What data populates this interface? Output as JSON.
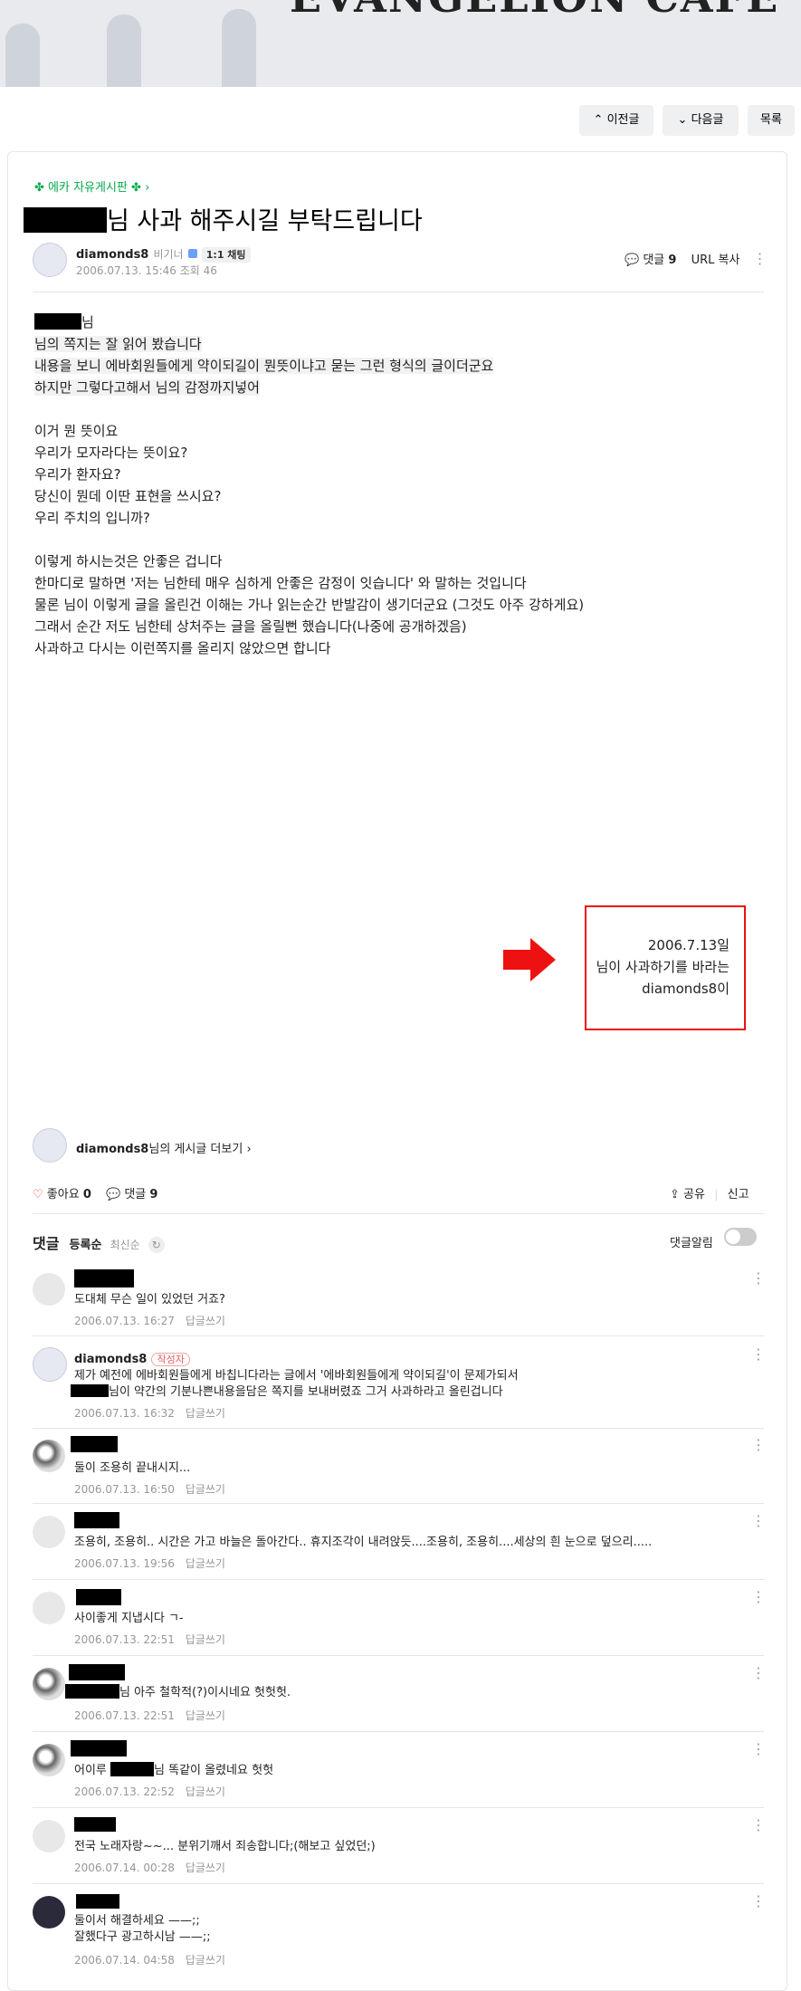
{
  "banner": {
    "title": "EVANGELION CAFE"
  },
  "nav": {
    "prev": "이전글",
    "next": "다음글",
    "list": "목록"
  },
  "board": {
    "link": "에카 자유게시판"
  },
  "post": {
    "title_suffix": "님 사과 해주시길 부탁드립니다",
    "author": "diamonds8",
    "rank": "비기너",
    "chat": "1:1 채팅",
    "date": "2006.07.13. 15:46",
    "views": "조회 46",
    "comment_label": "댓글",
    "comment_count": "9",
    "url_copy": "URL 복사",
    "lines": [
      "님",
      "님의 쪽지는 잘 읽어 봤습니다",
      "내용을 보니 에바회원들에게 약이되길이 뭔뜻이냐고 묻는 그런 형식의 글이더군요",
      "하지만 그렇다고해서 님의 감정까지넣어",
      "",
      "이거 뭔 뜻이요",
      "우리가 모자라다는 뜻이요?",
      "우리가 환자요?",
      "당신이 뭔데 이딴 표현을 쓰시요?",
      "우리 주치의 입니까?",
      "",
      "이렇게 하시는것은 안좋은 겁니다",
      "한마디로 말하면 '저는 님한테 매우 심하게 안좋은 감정이 잇습니다' 와 말하는 것입니다",
      "물론 님이 이렇게 글을 올린건 이해는 가나 읽는순간 반발감이 생기더군요 (그것도 아주 강하게요)",
      "그래서 순간 저도 님한테 상처주는 글을 올릴뻔 했습니다(나중에 공개하겠음)",
      "사과하고 다시는 이런쪽지를 올리지 않았으면 합니다"
    ],
    "note": [
      "2006.7.13일",
      "님이 사과하기를 바라는",
      "diamonds8이"
    ],
    "more_posts_suffix": "님의 게시글 더보기",
    "like_label": "좋아요",
    "like_count": "0",
    "share": "공유",
    "report": "신고"
  },
  "comments_header": {
    "title": "댓글",
    "sort_reg": "등록순",
    "sort_new": "최신순",
    "alarm": "댓글알림"
  },
  "reply_label": "답글쓰기",
  "writer_badge": "작성자",
  "comments": [
    {
      "text": "도대체 무슨 일이 있었던 거죠?",
      "date": "2006.07.13. 16:27"
    },
    {
      "author": "diamonds8",
      "text1": "제가 예전에 에바회원들에게 바칩니다라는 글에서 '에바회원들에게 약이되길'이 문제가되서",
      "text2": "님이 약간의 기분나쁜내용을담은 쪽지를 보내버렸죠 그거 사과하라고 올린겁니다",
      "date": "2006.07.13. 16:32"
    },
    {
      "text": "둘이 조용히 끝내시지...",
      "date": "2006.07.13. 16:50"
    },
    {
      "text": "조용히, 조용히.. 시간은 가고 바늘은 돌아간다.. 휴지조각이 내려앉듯....조용히, 조용히....세상의 흰 눈으로 덮으리.....",
      "date": "2006.07.13. 19:56"
    },
    {
      "text": "사이좋게 지냅시다 ㄱ-",
      "date": "2006.07.13. 22:51"
    },
    {
      "text": "님 아주 철학적(?)이시네요 헛헛헛.",
      "date": "2006.07.13. 22:51"
    },
    {
      "text_pre": "어이루",
      "text_post": "님 똑같이 올렸네요 헛헛",
      "date": "2006.07.13. 22:52"
    },
    {
      "text": "전국 노래자랑~~... 분위기깨서 죄송합니다;(해보고 싶었던;)",
      "date": "2006.07.14. 00:28"
    },
    {
      "text1": "둘이서 해결하세요 ——;;",
      "text2": "잘했다구 광고하시남 ——;;",
      "date": "2006.07.14. 04:58"
    }
  ]
}
